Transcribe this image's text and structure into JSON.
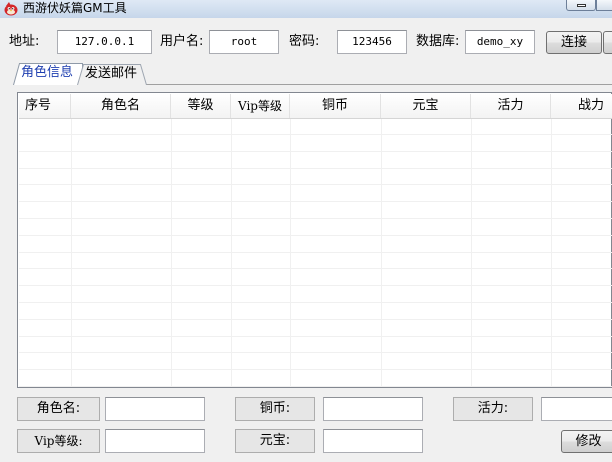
{
  "window": {
    "title": "西游伏妖篇GM工具"
  },
  "connection": {
    "address_label": "地址:",
    "address_value": "127.0.0.1",
    "user_label": "用户名:",
    "user_value": "root",
    "password_label": "密码:",
    "password_value": "123456",
    "database_label": "数据库:",
    "database_value": "demo_xy",
    "connect_label": "连接"
  },
  "tabs": [
    {
      "label": "角色信息",
      "active": true
    },
    {
      "label": "发送邮件",
      "active": false
    }
  ],
  "table": {
    "columns": [
      "序号",
      "角色名",
      "等级",
      "Vip等级",
      "铜币",
      "元宝",
      "活力",
      "战力"
    ],
    "rows": []
  },
  "form": {
    "role_name_label": "角色名:",
    "role_name_value": "",
    "copper_label": "铜币:",
    "copper_value": "",
    "vitality_label": "活力:",
    "vitality_value": "",
    "vip_level_label": "Vip等级:",
    "vip_level_value": "",
    "yuanbao_label": "元宝:",
    "yuanbao_value": "",
    "modify_label": "修改"
  },
  "colors": {
    "window_bg": "#f0f0f0",
    "active_tab_text": "#1f3fb0",
    "title_bar": "#c6d6ea"
  }
}
